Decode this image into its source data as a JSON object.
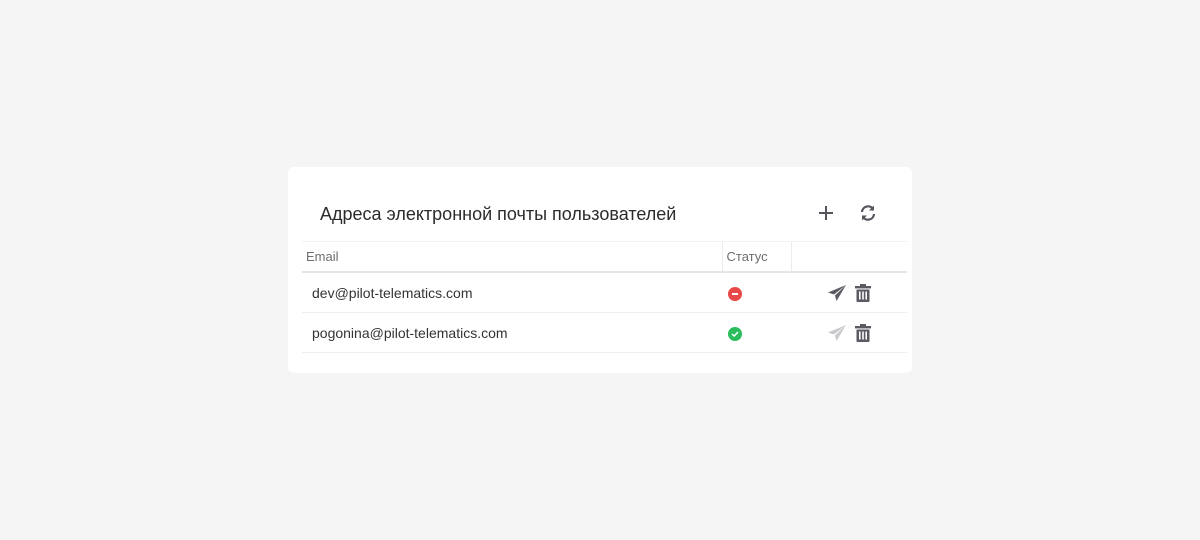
{
  "card": {
    "title": "Адреса электронной почты пользователей",
    "add_icon": "plus-icon",
    "refresh_icon": "refresh-icon"
  },
  "table": {
    "columns": [
      "Email",
      "Статус",
      ""
    ],
    "rows": [
      {
        "email": "dev@pilot-telematics.com",
        "status": "error",
        "status_icon": "minus-circle-icon",
        "status_color": "#e84848",
        "send_enabled": true
      },
      {
        "email": "pogonina@pilot-telematics.com",
        "status": "ok",
        "status_icon": "check-circle-icon",
        "status_color": "#2bbd5d",
        "send_enabled": false
      }
    ]
  },
  "colors": {
    "icon_active": "#5a5a63",
    "icon_disabled": "#c9c9cc",
    "background": "#f5f5f5",
    "card": "#ffffff"
  }
}
